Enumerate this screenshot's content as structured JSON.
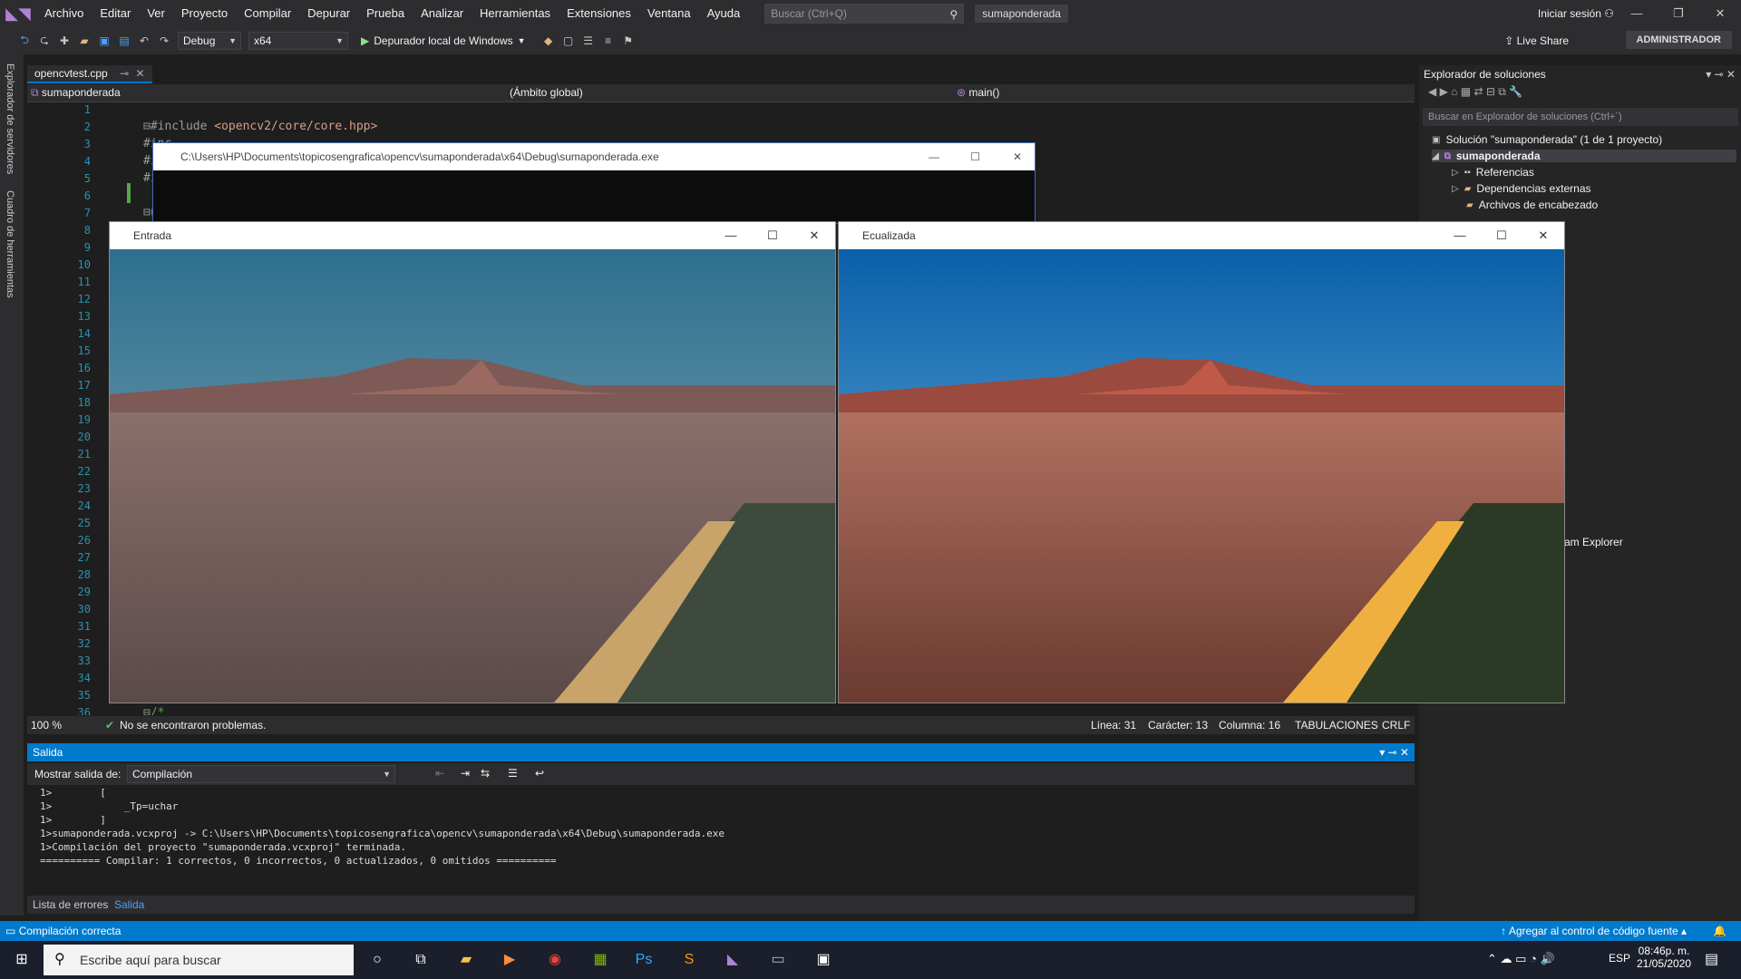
{
  "titlebar": {
    "menu": [
      "Archivo",
      "Editar",
      "Ver",
      "Proyecto",
      "Compilar",
      "Depurar",
      "Prueba",
      "Analizar",
      "Herramientas",
      "Extensiones",
      "Ventana",
      "Ayuda"
    ],
    "search_placeholder": "Buscar (Ctrl+Q)",
    "solution_name": "sumaponderada",
    "signin": "Iniciar sesión"
  },
  "toolbar": {
    "config": "Debug",
    "platform": "x64",
    "run_label": "Depurador local de Windows",
    "liveshare": "Live Share",
    "admin": "ADMINISTRADOR"
  },
  "left_strip": {
    "server_explorer": "Explorador de servidores",
    "toolbox": "Cuadro de herramientas"
  },
  "editor": {
    "tab": "opencvtest.cpp",
    "nav_project": "sumaponderada",
    "nav_scope": "(Ámbito global)",
    "nav_function": "main()",
    "line_numbers": [
      "1",
      "2",
      "3",
      "4",
      "5",
      "6",
      "7",
      "8",
      "9",
      "10",
      "11",
      "12",
      "13",
      "14",
      "15",
      "16",
      "17",
      "18",
      "19",
      "20",
      "21",
      "22",
      "23",
      "24",
      "25",
      "26",
      "27",
      "28",
      "29",
      "30",
      "31",
      "32",
      "33",
      "34",
      "35",
      "36"
    ],
    "code_include": "#include ",
    "code_include_path": "<opencv2/core/core.hpp>",
    "code_l3": "#inc",
    "code_l4": "#inc",
    "code_l5": "#incl",
    "code_l7": "using",
    "code_l36": "/*"
  },
  "editor_status": {
    "zoom": "100 %",
    "problems": "No se encontraron problemas.",
    "line": "Línea: 31",
    "char": "Carácter: 13",
    "column": "Columna: 16",
    "tabs": "TABULACIONES",
    "eol": "CRLF"
  },
  "solution_explorer": {
    "title": "Explorador de soluciones",
    "search_placeholder": "Buscar en Explorador de soluciones (Ctrl+´)",
    "solution": "Solución \"sumaponderada\" (1 de 1 proyecto)",
    "project": "sumaponderada",
    "references": "Referencias",
    "ext_deps": "Dependencias externas",
    "headers": "Archivos de encabezado",
    "team_explorer": "am Explorer"
  },
  "console_window": {
    "title": "C:\\Users\\HP\\Documents\\topicosengrafica\\opencv\\sumaponderada\\x64\\Debug\\sumaponderada.exe"
  },
  "image_windows": {
    "input_title": "Entrada",
    "equalized_title": "Ecualizada"
  },
  "output": {
    "title": "Salida",
    "show_from_label": "Mostrar salida de:",
    "show_from_value": "Compilación",
    "lines": [
      "1>        [",
      "1>            _Tp=uchar",
      "1>        ]",
      "1>sumaponderada.vcxproj -> C:\\Users\\HP\\Documents\\topicosengrafica\\opencv\\sumaponderada\\x64\\Debug\\sumaponderada.exe",
      "1>Compilación del proyecto \"sumaponderada.vcxproj\" terminada.",
      "========== Compilar: 1 correctos, 0 incorrectos, 0 actualizados, 0 omitidos =========="
    ],
    "tab_errors": "Lista de errores",
    "tab_output": "Salida"
  },
  "statusbar": {
    "message": "Compilación correcta",
    "source_control": "Agregar al control de código fuente"
  },
  "taskbar": {
    "search_placeholder": "Escribe aquí para buscar",
    "lang": "ESP",
    "time": "08:46p. m.",
    "date": "21/05/2020"
  },
  "colors": {
    "accent": "#007acc",
    "background": "#1e1e1e"
  }
}
